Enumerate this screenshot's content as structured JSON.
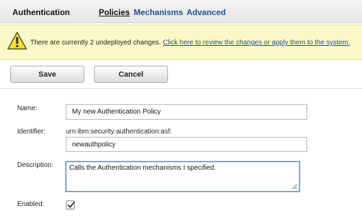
{
  "header": {
    "title": "Authentication",
    "tabs": [
      {
        "label": "Policies",
        "active": true
      },
      {
        "label": "Mechanisms",
        "active": false
      },
      {
        "label": "Advanced",
        "active": false
      }
    ]
  },
  "warning": {
    "icon": "warning-icon",
    "text": "There are currently 2 undeployed changes. ",
    "link": "Click here to review the changes or apply them to the system."
  },
  "toolbar": {
    "save_label": "Save",
    "cancel_label": "Cancel"
  },
  "form": {
    "name_label": "Name:",
    "name_value": "My new Authentication Policy",
    "identifier_label": "Identifier:",
    "identifier_prefix": "urn:ibm:security:authentication:asf:",
    "identifier_value": "newauthpolicy",
    "description_label": "Description:",
    "description_value": "Calls the Authentication mechanisms I specified.",
    "enabled_label": "Enabled:",
    "enabled": true
  },
  "colors": {
    "link": "#1f4f9a",
    "warning_bg": "#fbf7c6"
  }
}
